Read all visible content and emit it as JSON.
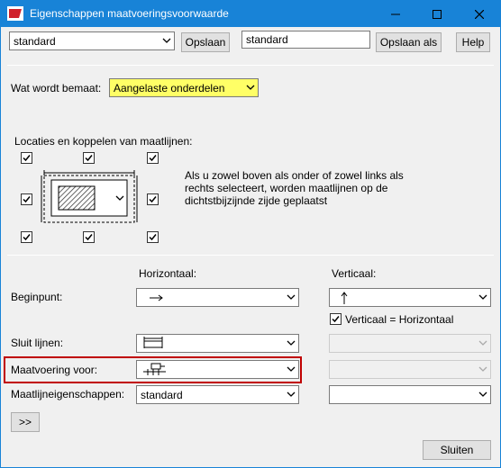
{
  "window": {
    "title": "Eigenschappen maatvoeringsvoorwaarde"
  },
  "toolbar": {
    "preset_value": "standard",
    "save_label": "Opslaan",
    "save_as_name": "standard",
    "save_as_label": "Opslaan als",
    "help_label": "Help"
  },
  "measured": {
    "label": "Wat wordt bemaat:",
    "value": "Aangelaste onderdelen"
  },
  "locations": {
    "label": "Locaties en koppelen van maatlijnen:",
    "hint_line1": "Als u zowel boven als onder of zowel links als",
    "hint_line2": "rechts selecteert, worden maatlijnen op de",
    "hint_line3": "dichtstbijzijnde zijde geplaatst",
    "checkboxes": [
      "checked",
      "checked",
      "checked",
      "checked",
      "checked",
      "checked",
      "checked",
      "checked"
    ]
  },
  "columns": {
    "horizontal": "Horizontaal:",
    "vertical": "Verticaal:"
  },
  "rows": {
    "start_label": "Beginpunt:",
    "vertical_equals_label": "Verticaal = Horizontaal",
    "close_label": "Sluit lijnen:",
    "dim_for_label": "Maatvoering voor:",
    "props_label": "Maatlijneigenschappen:",
    "props_value": "standard"
  },
  "footer": {
    "more_label": ">>",
    "close_label": "Sluiten"
  },
  "colors": {
    "titlebar": "#1883d7",
    "highlight": "#ffff66",
    "red_frame": "#c00000"
  }
}
